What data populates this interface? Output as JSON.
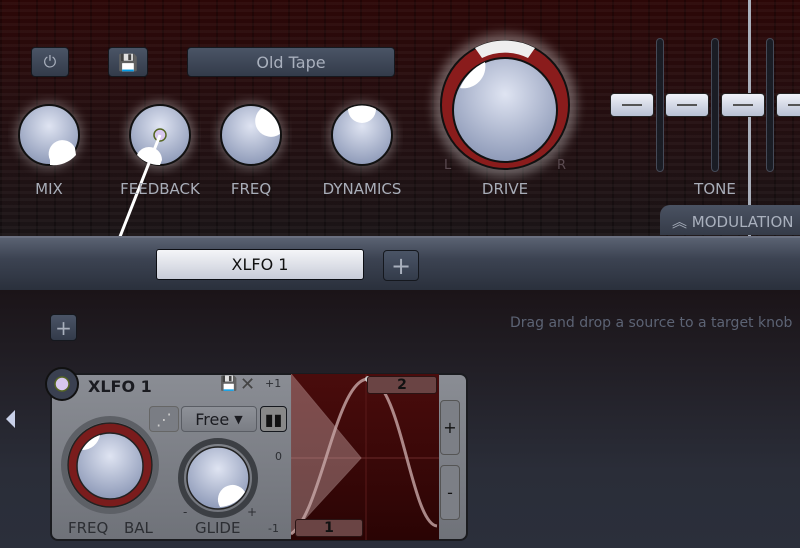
{
  "top": {
    "preset_name": "Old Tape",
    "knobs": [
      {
        "label": "MIX"
      },
      {
        "label": "FEEDBACK"
      },
      {
        "label": "FREQ"
      },
      {
        "label": "DYNAMICS"
      },
      {
        "label": "DRIVE"
      }
    ],
    "drive_left": "L",
    "drive_right": "R",
    "tone_label": "TONE",
    "modulation_tab": "MODULATION",
    "icons": [
      "power-icon",
      "save-icon"
    ]
  },
  "bar": {
    "tab": "XLFO 1",
    "add": "+"
  },
  "lower": {
    "hint": "Drag and drop a source to a target knob",
    "add": "+"
  },
  "xlfo": {
    "title": "XLFO 1",
    "mode": "Free",
    "freq": "FREQ",
    "bal": "BAL",
    "glide": "GLIDE",
    "glide_minus": "-",
    "glide_plus": "+",
    "axis": {
      "top": "+1",
      "mid": "0",
      "bottom": "-1"
    },
    "point1": "1",
    "point2": "2",
    "plus": "+",
    "minus": "-"
  },
  "colors": {
    "accent_red": "#8a1c1c",
    "knob": "#b8c4e0"
  }
}
